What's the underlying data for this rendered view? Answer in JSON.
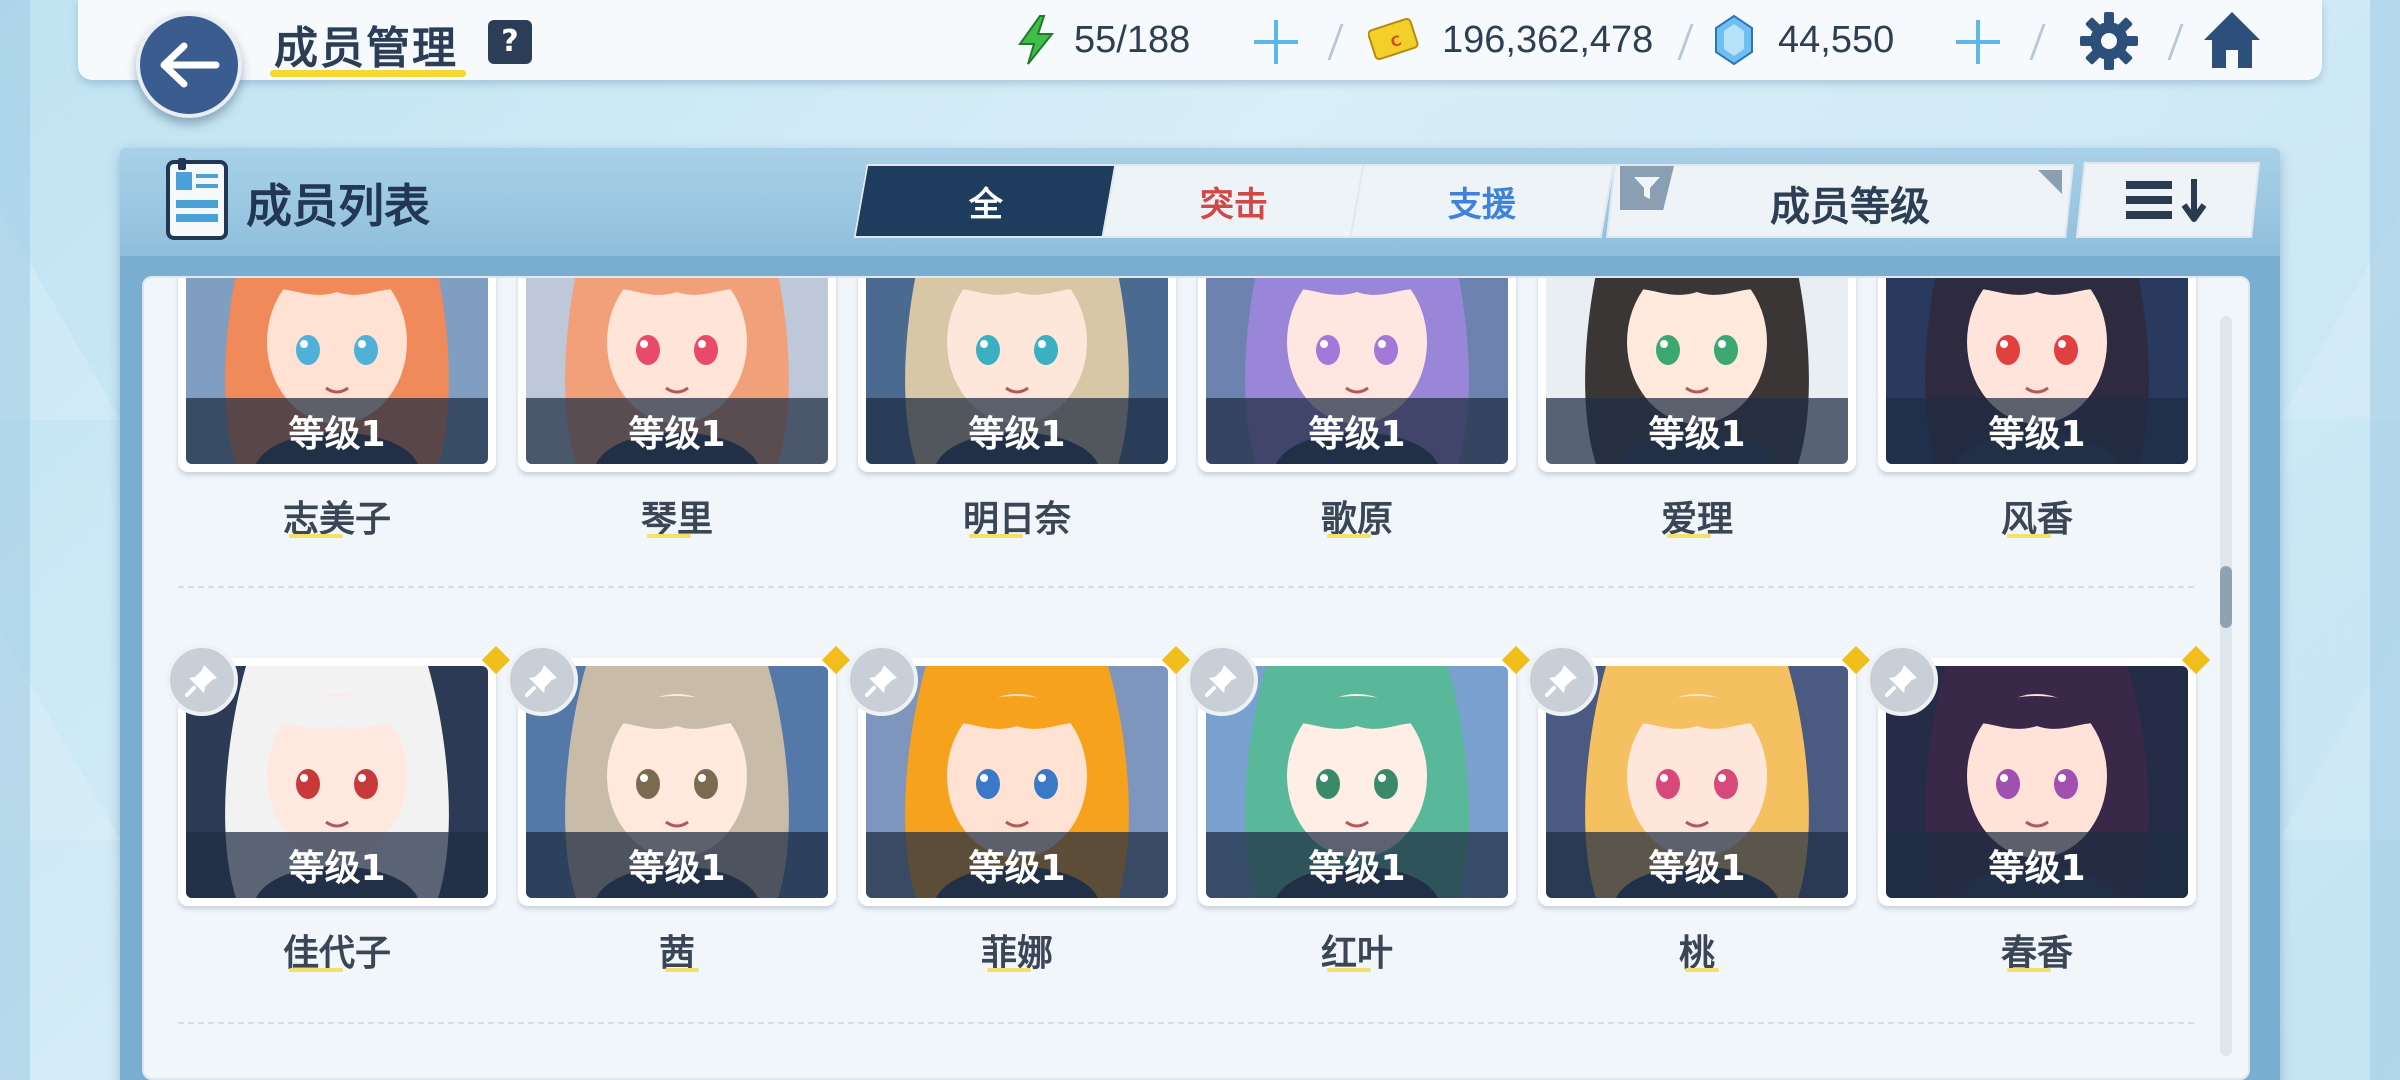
{
  "header": {
    "title": "成员管理",
    "help_label": "?",
    "stamina": "55/188",
    "credits": "196,362,478",
    "gems": "44,550"
  },
  "panel": {
    "title": "成员列表",
    "tabs": [
      {
        "label": "全"
      },
      {
        "label": "突击"
      },
      {
        "label": "支援"
      }
    ],
    "sort_filter": "成员等级"
  },
  "members": [
    {
      "name": "志美子",
      "level": "等级1",
      "hair": "#f08a5a",
      "bg": "#7f9ec2",
      "skin": "#ffe2d4",
      "eye": "#4fb0d8"
    },
    {
      "name": "琴里",
      "level": "等级1",
      "hair": "#f2a07a",
      "bg": "#bfc8d8",
      "skin": "#ffe4d8",
      "eye": "#e84a6a"
    },
    {
      "name": "明日奈",
      "level": "等级1",
      "hair": "#d8c7a6",
      "bg": "#4a6a90",
      "skin": "#ffe6da",
      "eye": "#3ab0c0"
    },
    {
      "name": "歌原",
      "level": "等级1",
      "hair": "#9a86d8",
      "bg": "#6e82b0",
      "skin": "#ffe6e0",
      "eye": "#a378d8"
    },
    {
      "name": "爱理",
      "level": "等级1",
      "hair": "#3a3636",
      "bg": "#e8eef2",
      "skin": "#ffe8dc",
      "eye": "#3aa870"
    },
    {
      "name": "风香",
      "level": "等级1",
      "hair": "#2e2a40",
      "bg": "#2a3a5e",
      "skin": "#ffe4dc",
      "eye": "#e24040"
    },
    {
      "name": "佳代子",
      "level": "等级1",
      "hair": "#f2f2f2",
      "bg": "#2c3a56",
      "skin": "#ffe8e0",
      "eye": "#c83a3a"
    },
    {
      "name": "茜",
      "level": "等级1",
      "hair": "#c8bca8",
      "bg": "#5478a8",
      "skin": "#ffe8dc",
      "eye": "#7a6a50"
    },
    {
      "name": "菲娜",
      "level": "等级1",
      "hair": "#f7a21c",
      "bg": "#7e96be",
      "skin": "#ffe2d2",
      "eye": "#3a78c8"
    },
    {
      "name": "红叶",
      "level": "等级1",
      "hair": "#5ab89a",
      "bg": "#7aa0d0",
      "skin": "#ffeee6",
      "eye": "#3a8a6a"
    },
    {
      "name": "桃",
      "level": "等级1",
      "hair": "#f5c060",
      "bg": "#4a5a80",
      "skin": "#ffe6da",
      "eye": "#d8487a"
    },
    {
      "name": "春香",
      "level": "等级1",
      "hair": "#3a2848",
      "bg": "#242c48",
      "skin": "#ffe2d8",
      "eye": "#a050b0"
    }
  ],
  "icons": {
    "back": "arrow-left-icon",
    "stamina": "lightning-icon",
    "credits": "credit-card-icon",
    "gems": "gem-icon",
    "settings": "gear-icon",
    "home": "home-icon",
    "filter": "funnel-icon",
    "sort": "sort-descending-icon",
    "pin": "pin-icon"
  },
  "colors": {
    "accent_navy": "#1d3c5e",
    "strike_red": "#d04848",
    "support_blue": "#3f82d8",
    "plus_blue": "#5fb6e8"
  }
}
